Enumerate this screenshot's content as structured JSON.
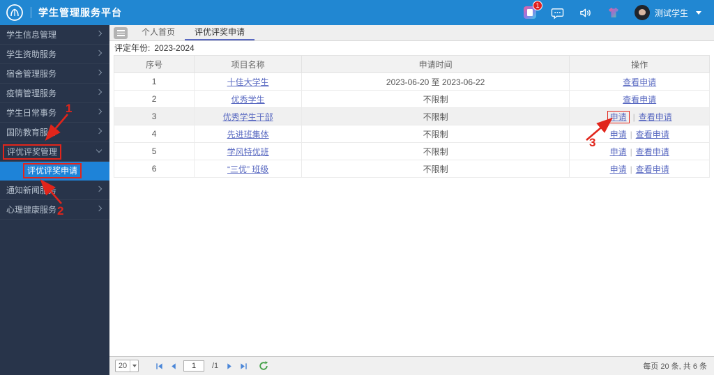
{
  "header": {
    "title": "学生管理服务平台",
    "badge_count": "1",
    "user_name": "测试学生"
  },
  "sidebar": {
    "items": [
      {
        "label": "学生信息管理"
      },
      {
        "label": "学生资助服务"
      },
      {
        "label": "宿舍管理服务"
      },
      {
        "label": "疫情管理服务"
      },
      {
        "label": "学生日常事务"
      },
      {
        "label": "国防教育服务"
      },
      {
        "label": "评优评奖管理"
      },
      {
        "label": "评优评奖申请"
      },
      {
        "label": "通知新闻服务"
      },
      {
        "label": "心理健康服务"
      }
    ]
  },
  "tabs": {
    "home": "个人首页",
    "current": "评优评奖申请"
  },
  "filter": {
    "label": "评定年份:",
    "value": "2023-2024"
  },
  "table": {
    "columns": [
      "序号",
      "项目名称",
      "申请时间",
      "操作"
    ],
    "action_separator": "|",
    "rows": [
      {
        "no": "1",
        "name": "十佳大学生",
        "time": "2023-06-20 至 2023-06-22",
        "actions": [
          "查看申请"
        ]
      },
      {
        "no": "2",
        "name": "优秀学生",
        "time": "不限制",
        "actions": [
          "查看申请"
        ]
      },
      {
        "no": "3",
        "name": "优秀学生干部",
        "time": "不限制",
        "actions": [
          "申请",
          "查看申请"
        ]
      },
      {
        "no": "4",
        "name": "先进班集体",
        "time": "不限制",
        "actions": [
          "申请",
          "查看申请"
        ]
      },
      {
        "no": "5",
        "name": "学风特优班",
        "time": "不限制",
        "actions": [
          "申请",
          "查看申请"
        ]
      },
      {
        "no": "6",
        "name": "“三优” 班级",
        "time": "不限制",
        "actions": [
          "申请",
          "查看申请"
        ]
      }
    ]
  },
  "pagination": {
    "page_size": "20",
    "page": "1",
    "total": "/1",
    "summary": "每页 20 条, 共 6 条"
  },
  "annotations": {
    "step1": "1",
    "step2": "2",
    "step3": "3"
  },
  "colors": {
    "header_bg": "#2187d2",
    "sidebar_bg": "#28344a",
    "active_item_bg": "#1e83d8",
    "link": "#5969c1",
    "annotation_red": "#e1251b"
  }
}
